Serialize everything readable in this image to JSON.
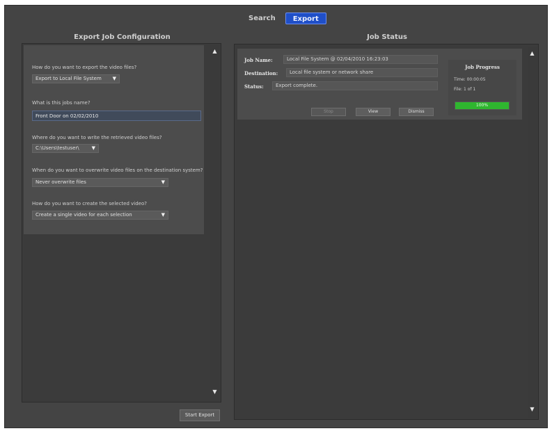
{
  "tabs": [
    {
      "label": "Search",
      "active": false
    },
    {
      "label": "Export",
      "active": true
    }
  ],
  "colors": {
    "accent_tab": "#1f4fc8",
    "progress": "#2fb62f"
  },
  "left": {
    "title": "Export Job Configuration",
    "questions": [
      {
        "label": "How do you want to export the video files?",
        "value": "Export to Local File System"
      },
      {
        "label": "What is this jobs name?",
        "value": "Front Door on 02/02/2010"
      },
      {
        "label": "Where do you want to write the retrieved video files?",
        "value": "C:\\Users\\testuser\\"
      },
      {
        "label": "When do you want to overwrite video files on the destination system?",
        "value": "Never overwrite files"
      },
      {
        "label": "How do you want to create the selected video?",
        "value": "Create a single video for each selection"
      }
    ],
    "start_button": "Start Export"
  },
  "right": {
    "title": "Job Status",
    "job": {
      "name_label": "Job Name:",
      "name_value": "Local File System @ 02/04/2010 16:23:03",
      "destination_label": "Destination:",
      "destination_value": "Local file system or network share",
      "status_label": "Status:",
      "status_value": "Export complete.",
      "buttons": [
        {
          "label": "Stop",
          "enabled": false
        },
        {
          "label": "View",
          "enabled": true
        },
        {
          "label": "Dismiss",
          "enabled": true
        }
      ]
    },
    "progress": {
      "title": "Job Progress",
      "time": "Time: 00:00:05",
      "file": "File: 1 of 1",
      "percent_text": "100%",
      "percent": 100
    }
  }
}
